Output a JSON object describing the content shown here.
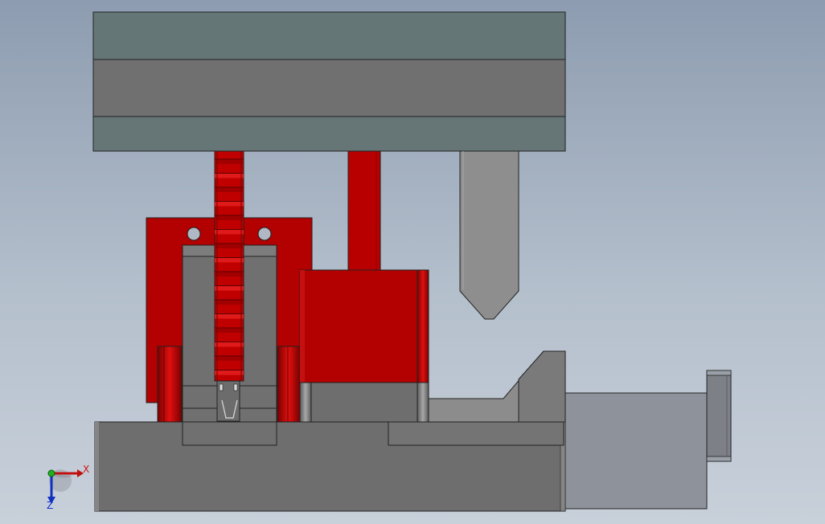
{
  "viewport": {
    "background_top": "#8d9cb0",
    "background_bottom": "#c8d0da"
  },
  "colors": {
    "plate_dark": "#657575",
    "plate_gray": "#727272",
    "part_gray": "#6f6f6f",
    "part_light": "#8a8a8a",
    "red": "#b30000",
    "red_dark": "#8a0000",
    "outline": "#222222"
  },
  "triad": {
    "x_label": "X",
    "z_label": "Z",
    "x_color": "#d01010",
    "y_color": "#10b010",
    "z_color": "#1030d0"
  }
}
